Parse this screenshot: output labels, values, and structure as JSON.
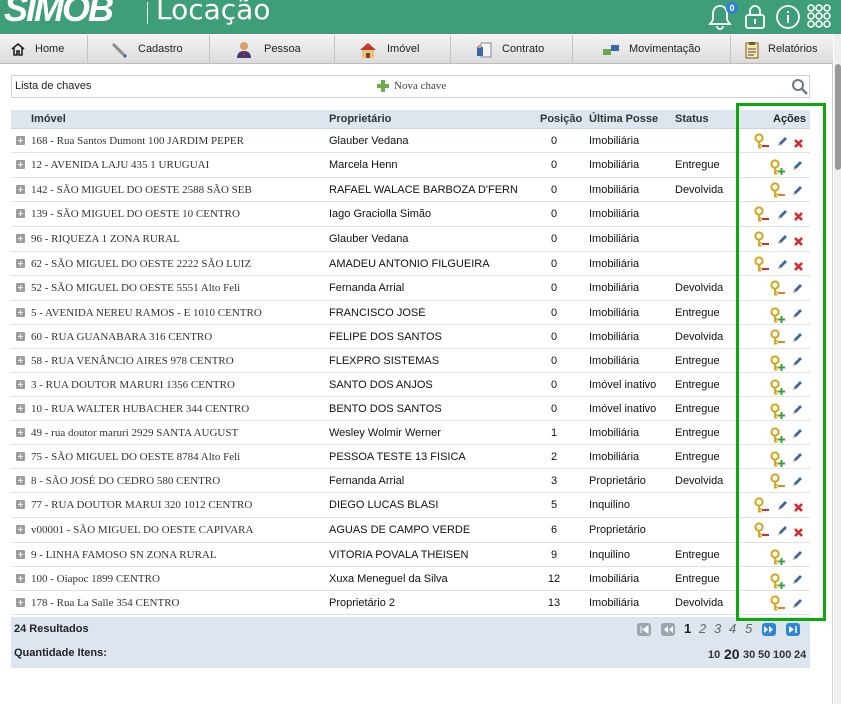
{
  "app": {
    "logo": "SIMOB",
    "module": "Locação",
    "notification_count": "0"
  },
  "menu": [
    {
      "label": "Home",
      "icon": "home-icon"
    },
    {
      "label": "Cadastro",
      "icon": "pencil-icon"
    },
    {
      "label": "Pessoa",
      "icon": "person-icon"
    },
    {
      "label": "Imóvel",
      "icon": "house-icon"
    },
    {
      "label": "Contrato",
      "icon": "contract-icon"
    },
    {
      "label": "Movimentação",
      "icon": "transfer-icon"
    },
    {
      "label": "Relatórios",
      "icon": "report-icon"
    }
  ],
  "search": {
    "label": "Lista de chaves",
    "new_label": "Nova chave"
  },
  "columns": {
    "imovel": "Imóvel",
    "proprietario": "Proprietário",
    "posicao": "Posição",
    "ultima_posse": "Última Posse",
    "status": "Status",
    "acoes": "Ações"
  },
  "rows": [
    {
      "imovel": "168 - Rua Santos Dumont 100 JARDIM PEPER",
      "prop": "Glauber Vedana",
      "pos": "0",
      "posse": "Imobiliária",
      "status": "",
      "actions": "remove"
    },
    {
      "imovel": "12 - AVENIDA LAJU 435 1 URUGUAI",
      "prop": "Marcela Henn",
      "pos": "0",
      "posse": "Imobiliária",
      "status": "Entregue",
      "actions": "add"
    },
    {
      "imovel": "142 - SÃO MIGUEL DO OESTE 2588 SÃO SEB",
      "prop": "RAFAEL WALACE BARBOZA D'FERN",
      "pos": "0",
      "posse": "Imobiliária",
      "status": "Devolvida",
      "actions": "return"
    },
    {
      "imovel": "139 - SÃO MIGUEL DO OESTE 10 CENTRO",
      "prop": "Iago Graciolla Simão",
      "pos": "0",
      "posse": "Imobiliária",
      "status": "",
      "actions": "remove"
    },
    {
      "imovel": "96 - RIQUEZA 1 ZONA RURAL",
      "prop": "Glauber Vedana",
      "pos": "0",
      "posse": "Imobiliária",
      "status": "",
      "actions": "remove"
    },
    {
      "imovel": "62 - SÃO MIGUEL DO OESTE 2222 SÃO LUIZ",
      "prop": "AMADEU ANTONIO FILGUEIRA",
      "pos": "0",
      "posse": "Imobiliária",
      "status": "",
      "actions": "remove"
    },
    {
      "imovel": "52 - SÃO MIGUEL DO OESTE 5551 Alto Feli",
      "prop": "Fernanda Arrial",
      "pos": "0",
      "posse": "Imobiliária",
      "status": "Devolvida",
      "actions": "return"
    },
    {
      "imovel": "5 - AVENIDA NEREU RAMOS - E 1010 CENTRO",
      "prop": "FRANCISCO JOSÉ",
      "pos": "0",
      "posse": "Imobiliária",
      "status": "Entregue",
      "actions": "add"
    },
    {
      "imovel": "60 - RUA GUANABARA 316 CENTRO",
      "prop": "FELIPE DOS SANTOS",
      "pos": "0",
      "posse": "Imobiliária",
      "status": "Devolvida",
      "actions": "return"
    },
    {
      "imovel": "58 - RUA VENÂNCIO AIRES 978 CENTRO",
      "prop": "FLEXPRO SISTEMAS",
      "pos": "0",
      "posse": "Imobiliária",
      "status": "Entregue",
      "actions": "add"
    },
    {
      "imovel": "3 - RUA DOUTOR MARURI 1356 CENTRO",
      "prop": "SANTO DOS ANJOS",
      "pos": "0",
      "posse": "Imóvel inativo",
      "status": "Entregue",
      "actions": "add"
    },
    {
      "imovel": "10 - RUA WALTER HUBACHER 344 CENTRO",
      "prop": "BENTO DOS SANTOS",
      "pos": "0",
      "posse": "Imóvel inativo",
      "status": "Entregue",
      "actions": "add"
    },
    {
      "imovel": "49 - rua doutor maruri 2929 SANTA AUGUST",
      "prop": "Wesley Wolmir Werner",
      "pos": "1",
      "posse": "Imobiliária",
      "status": "Entregue",
      "actions": "add"
    },
    {
      "imovel": "75 - SÃO MIGUEL DO OESTE 8784 Alto Feli",
      "prop": "PESSOA TESTE 13 FISICA",
      "pos": "2",
      "posse": "Imobiliária",
      "status": "Entregue",
      "actions": "add"
    },
    {
      "imovel": "8 - SÃO JOSÉ DO CEDRO 580 CENTRO",
      "prop": "Fernanda Arrial",
      "pos": "3",
      "posse": "Proprietário",
      "status": "Devolvida",
      "actions": "return"
    },
    {
      "imovel": "77 - RUA DOUTOR MARUI 320 1012 CENTRO",
      "prop": "DIEGO LUCAS BLASI",
      "pos": "5",
      "posse": "Inquilino",
      "status": "",
      "actions": "remove"
    },
    {
      "imovel": "v00001 - SÃO MIGUEL DO OESTE CAPIVARA",
      "prop": "AGUAS DE CAMPO VERDE",
      "pos": "6",
      "posse": "Proprietário",
      "status": "",
      "actions": "remove"
    },
    {
      "imovel": "9 - LINHA FAMOSO SN ZONA RURAL",
      "prop": "VITORIA POVALA THEISEN",
      "pos": "9",
      "posse": "Inquilino",
      "status": "Entregue",
      "actions": "add"
    },
    {
      "imovel": "100 - Oiapoc 1899 CENTRO",
      "prop": "Xuxa Meneguel da Silva",
      "pos": "12",
      "posse": "Imobiliária",
      "status": "Entregue",
      "actions": "add"
    },
    {
      "imovel": "178 - Rua La Salle 354 CENTRO",
      "prop": "Proprietário 2",
      "pos": "13",
      "posse": "Imobiliária",
      "status": "Devolvida",
      "actions": "return"
    }
  ],
  "footer": {
    "results": "24 Resultados",
    "qty_label": "Quantidade Itens:",
    "pages": [
      "1",
      "2",
      "3",
      "4",
      "5"
    ],
    "current_page": "1",
    "page_sizes": [
      "10",
      "20",
      "30",
      "50",
      "100",
      "24"
    ],
    "current_size": "20"
  },
  "colors": {
    "header": "#3f9e7a",
    "highlight": "#0ea70e",
    "grid_head": "#dde6ee"
  }
}
